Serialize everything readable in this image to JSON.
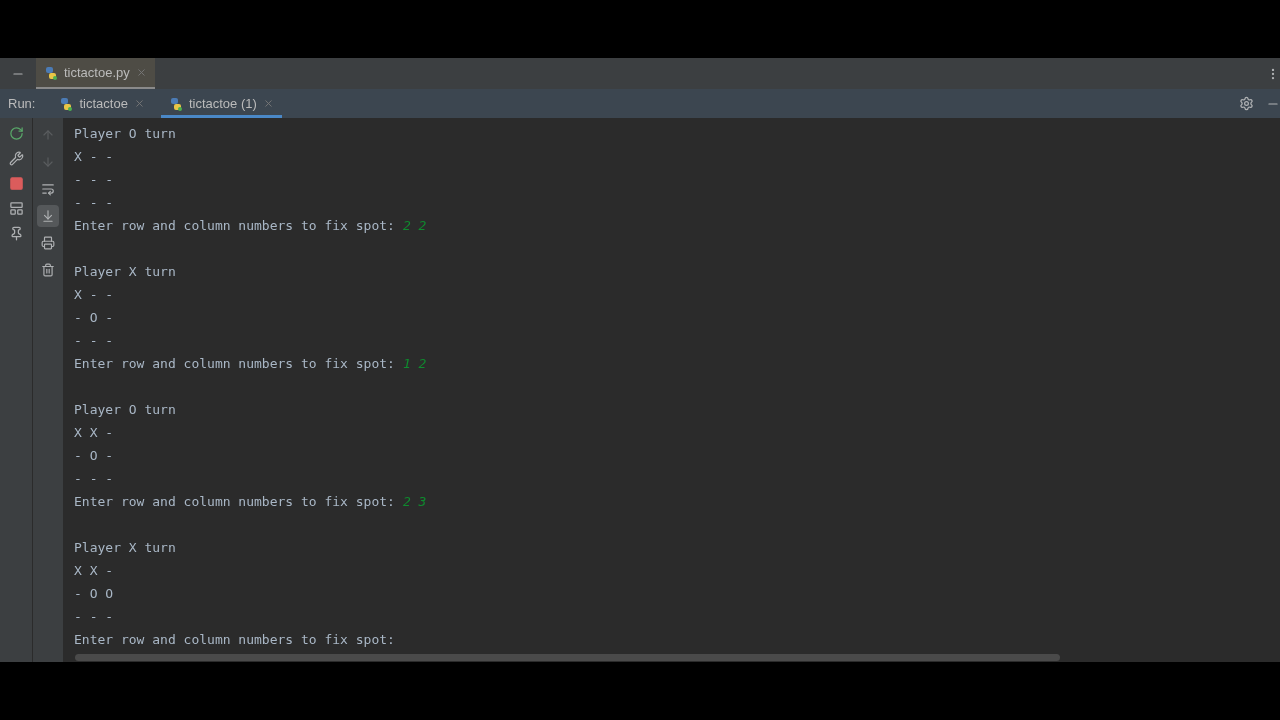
{
  "editor_tabs": [
    {
      "label": "tictactoe.py",
      "selected": true
    }
  ],
  "run_bar": {
    "label": "Run:",
    "tabs": [
      {
        "label": "tictactoe",
        "selected": false
      },
      {
        "label": "tictactoe (1)",
        "selected": true
      }
    ]
  },
  "left_toolbar": [
    {
      "kind": "rerun"
    },
    {
      "kind": "wrench"
    },
    {
      "kind": "stop"
    },
    {
      "kind": "layout"
    },
    {
      "kind": "pin"
    }
  ],
  "console_toolbar": [
    {
      "kind": "up",
      "disabled": true,
      "selected": false
    },
    {
      "kind": "down",
      "disabled": true,
      "selected": false
    },
    {
      "kind": "wrap",
      "disabled": false,
      "selected": false
    },
    {
      "kind": "scroll_end",
      "disabled": false,
      "selected": true
    },
    {
      "kind": "print",
      "disabled": false,
      "selected": false
    },
    {
      "kind": "trash",
      "disabled": false,
      "selected": false
    }
  ],
  "console": [
    {
      "kind": "text",
      "text": "Player O turn"
    },
    {
      "kind": "text",
      "text": "X - -"
    },
    {
      "kind": "text",
      "text": "- - -"
    },
    {
      "kind": "text",
      "text": "- - -"
    },
    {
      "kind": "prompt",
      "text": "Enter row and column numbers to fix spot:",
      "input": "2 2"
    },
    {
      "kind": "blank"
    },
    {
      "kind": "text",
      "text": "Player X turn"
    },
    {
      "kind": "text",
      "text": "X - -"
    },
    {
      "kind": "text",
      "text": "- O -"
    },
    {
      "kind": "text",
      "text": "- - -"
    },
    {
      "kind": "prompt",
      "text": "Enter row and column numbers to fix spot:",
      "input": "1 2"
    },
    {
      "kind": "blank"
    },
    {
      "kind": "text",
      "text": "Player O turn"
    },
    {
      "kind": "text",
      "text": "X X -"
    },
    {
      "kind": "text",
      "text": "- O -"
    },
    {
      "kind": "text",
      "text": "- - -"
    },
    {
      "kind": "prompt",
      "text": "Enter row and column numbers to fix spot:",
      "input": "2 3"
    },
    {
      "kind": "blank"
    },
    {
      "kind": "text",
      "text": "Player X turn"
    },
    {
      "kind": "text",
      "text": "X X -"
    },
    {
      "kind": "text",
      "text": "- O O"
    },
    {
      "kind": "text",
      "text": "- - -"
    },
    {
      "kind": "prompt",
      "text": "Enter row and column numbers to fix spot:"
    }
  ]
}
